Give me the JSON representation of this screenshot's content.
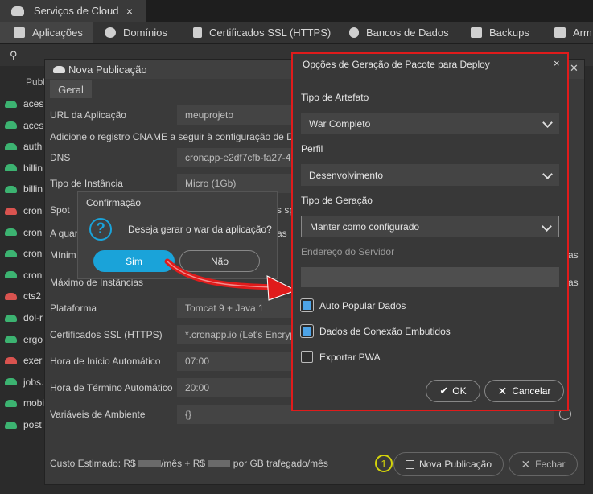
{
  "window_tab": {
    "title": "Serviços de Cloud",
    "close": "×"
  },
  "nav": {
    "applications": "Aplicações",
    "domains": "Domínios",
    "ssl": "Certificados SSL (HTTPS)",
    "databases": "Bancos de Dados",
    "backups": "Backups",
    "storage": "Arm"
  },
  "list": {
    "header": "Publ",
    "items": [
      {
        "label": "aces",
        "color": "#3cb371"
      },
      {
        "label": "aces",
        "color": "#3cb371"
      },
      {
        "label": "auth",
        "color": "#3cb371"
      },
      {
        "label": "billin",
        "color": "#3cb371"
      },
      {
        "label": "billin",
        "color": "#3cb371"
      },
      {
        "label": "cron",
        "color": "#d9534f"
      },
      {
        "label": "cron",
        "color": "#3cb371"
      },
      {
        "label": "cron",
        "color": "#3cb371"
      },
      {
        "label": "cron",
        "color": "#3cb371"
      },
      {
        "label": "cts2",
        "color": "#d9534f"
      },
      {
        "label": "dol-r",
        "color": "#3cb371"
      },
      {
        "label": "ergo",
        "color": "#3cb371"
      },
      {
        "label": "exer",
        "color": "#d9534f"
      },
      {
        "label": "jobs.",
        "color": "#3cb371"
      },
      {
        "label": "mobi",
        "color": "#3cb371"
      },
      {
        "label": "post",
        "color": "#3cb371"
      }
    ]
  },
  "main_dialog": {
    "title": "Nova Publicação",
    "tab": "Geral",
    "fields": {
      "app_url_label": "URL da Aplicação",
      "app_url_value": "meuprojeto",
      "cname_note": "Adicione o registro CNAME a seguir à configuração de D",
      "dns_label": "DNS",
      "dns_value": "cronapp-e2df7cfb-fa27-4",
      "instance_label": "Tipo de Instância",
      "instance_value": "Micro (1Gb)",
      "spot_label": "Spot",
      "spot_suffix": "s sp",
      "qty_label": "A quan",
      "qty_suffix": "as",
      "min_label": "Mínim",
      "min_suffix": "as",
      "max_label": "Máximo de Instâncias",
      "max_suffix": "as",
      "platform_label": "Plataforma",
      "platform_value": "Tomcat 9 + Java 1",
      "ssl_label": "Certificados SSL (HTTPS)",
      "ssl_value": "*.cronapp.io (Let's Encryp",
      "start_label": "Hora de Início Automático",
      "start_value": "07:00",
      "end_label": "Hora de Término Automático",
      "end_value": "20:00",
      "env_label": "Variáveis de Ambiente",
      "env_value": "{}"
    },
    "footer": {
      "cost_prefix": "Custo Estimado: R$",
      "cost_mid": "/mês + R$",
      "cost_suffix": "por GB trafegado/mês",
      "step_number": "1",
      "publish_button": "Nova Publicação",
      "close_button": "Fechar"
    }
  },
  "confirm_dialog": {
    "title": "Confirmação",
    "message": "Deseja gerar o war da aplicação?",
    "yes": "Sim",
    "no": "Não"
  },
  "options_dialog": {
    "title": "Opções de Geração de Pacote para Deploy",
    "close": "×",
    "artifact_label": "Tipo de Artefato",
    "artifact_value": "War Completo",
    "profile_label": "Perfil",
    "profile_value": "Desenvolvimento",
    "generation_label": "Tipo de Geração",
    "generation_value": "Manter como configurado",
    "server_label": "Endereço do Servidor",
    "server_value": "",
    "checkboxes": [
      {
        "label": "Auto Popular Dados",
        "checked": true
      },
      {
        "label": "Dados de Conexão Embutidos",
        "checked": true
      },
      {
        "label": "Exportar PWA",
        "checked": false
      }
    ],
    "ok": "OK",
    "cancel": "Cancelar"
  },
  "colors": {
    "accent": "#1aa3d9",
    "highlight": "#e01b1b",
    "step_marker": "#d4d40a"
  }
}
